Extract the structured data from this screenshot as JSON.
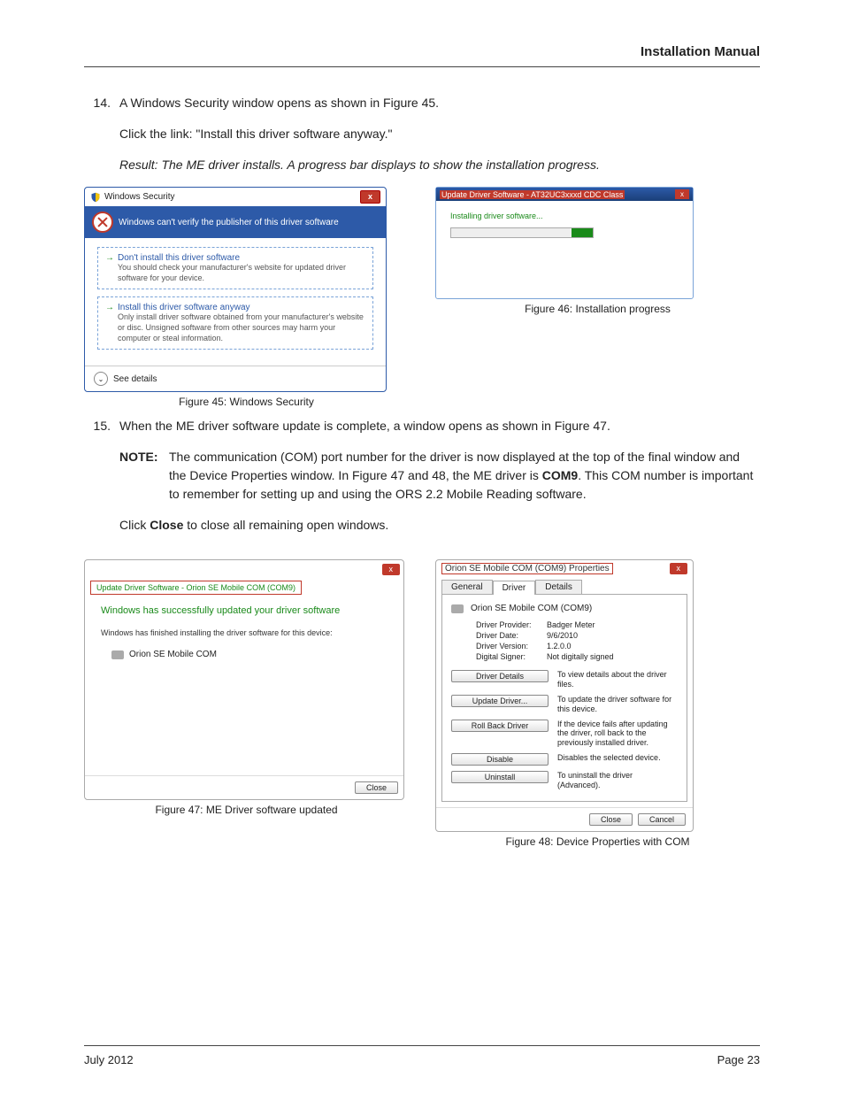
{
  "header": {
    "title": "Installation Manual"
  },
  "footer": {
    "left": "July 2012",
    "right": "Page 23"
  },
  "step14": {
    "num": "14.",
    "line1": "A Windows Security window opens as shown in Figure 45.",
    "line2": "Click the link: \"Install this driver software anyway.\"",
    "line3": "Result: The ME driver installs. A progress bar displays to show the installation progress."
  },
  "fig45": {
    "title": "Windows Security",
    "warning": "Windows can't verify the publisher of this driver software",
    "opt1": {
      "title": "Don't install this driver software",
      "sub": "You should check your manufacturer's website for updated driver software for your device."
    },
    "opt2": {
      "title": "Install this driver software anyway",
      "sub": "Only install driver software obtained from your manufacturer's website or disc. Unsigned software from other sources may harm your computer or steal information."
    },
    "details": "See details",
    "caption": "Figure 45:  Windows Security"
  },
  "fig46": {
    "title": "Update Driver Software - AT32UC3xxxd CDC Class",
    "body": "Installing driver software...",
    "caption": "Figure 46:  Installation progress"
  },
  "step15": {
    "num": "15.",
    "line1": "When the ME driver software update is complete, a window opens as shown in Figure 47.",
    "note_lbl": "NOTE:",
    "note_a": "The communication (COM) port number for the driver is now displayed at the top of the final window and the Device Properties window. In Figure 47 and 48, the ME driver is ",
    "note_b": "COM9",
    "note_c": ". This COM number is important to remember for setting up and using the ORS 2.2 Mobile Reading software.",
    "close_a": "Click ",
    "close_b": "Close",
    "close_c": " to close all remaining open windows."
  },
  "fig47": {
    "crumb": "Update Driver Software - Orion SE Mobile COM (COM9)",
    "h": "Windows has successfully updated your driver software",
    "line": "Windows has finished installing the driver software for this device:",
    "item": "Orion SE Mobile COM",
    "close": "Close",
    "caption": "Figure 47:  ME Driver software updated"
  },
  "fig48": {
    "title": "Orion SE Mobile COM (COM9) Properties",
    "tabs": {
      "general": "General",
      "driver": "Driver",
      "details": "Details"
    },
    "device": "Orion SE Mobile COM (COM9)",
    "kv": {
      "provider_k": "Driver Provider:",
      "provider_v": "Badger Meter",
      "date_k": "Driver Date:",
      "date_v": "9/6/2010",
      "ver_k": "Driver Version:",
      "ver_v": "1.2.0.0",
      "sign_k": "Digital Signer:",
      "sign_v": "Not digitally signed"
    },
    "actions": {
      "details_b": "Driver Details",
      "details_d": "To view details about the driver files.",
      "update_b": "Update Driver...",
      "update_d": "To update the driver software for this device.",
      "rollback_b": "Roll Back Driver",
      "rollback_d": "If the device fails after updating the driver, roll back to the previously installed driver.",
      "disable_b": "Disable",
      "disable_d": "Disables the selected device.",
      "uninstall_b": "Uninstall",
      "uninstall_d": "To uninstall the driver (Advanced)."
    },
    "foot": {
      "close": "Close",
      "cancel": "Cancel"
    },
    "caption": "Figure 48:  Device Properties with COM"
  }
}
